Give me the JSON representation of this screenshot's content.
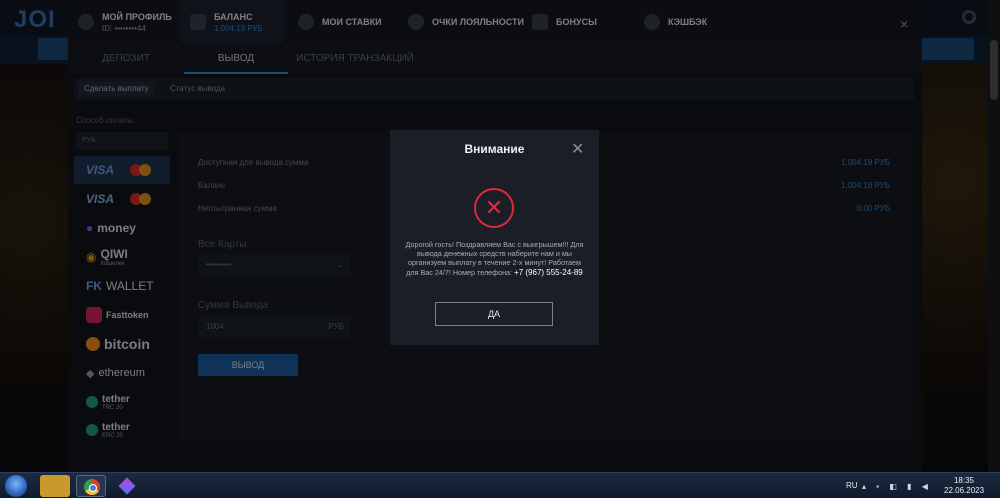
{
  "site": {
    "logo": "JOI"
  },
  "header": {
    "tabs": [
      {
        "title": "МОЙ ПРОФИЛЬ",
        "sub": "ID: ••••••••44",
        "icon": "user-icon"
      },
      {
        "title": "БАЛАНС",
        "sub": "1,004.19 РУБ",
        "icon": "wallet-icon"
      },
      {
        "title": "МОИ СТАВКИ",
        "icon": "trophy-icon"
      },
      {
        "title": "ОЧКИ ЛОЯЛЬНОСТИ",
        "icon": "star-icon"
      },
      {
        "title": "БОНУСЫ",
        "icon": "gift-icon"
      },
      {
        "title": "КЭШБЭК",
        "icon": "cashback-icon"
      }
    ],
    "close": "×",
    "lang": "RU"
  },
  "subtabs": [
    "ДЕПОЗИТ",
    "ВЫВОД",
    "ИСТОРИЯ ТРАНЗАКЦИЙ"
  ],
  "pills": [
    "Сделать выплату",
    "Статус вывода"
  ],
  "payment": {
    "label": "Способ оплаты",
    "currency": "РУБ",
    "methods": [
      {
        "name": "VISA",
        "icon": "mastercard-icon"
      },
      {
        "name": "VISA",
        "icon": "mastercard-icon"
      },
      {
        "name": "money",
        "icon": "yoomoney-icon"
      },
      {
        "name": "QIWI",
        "small": "Кошелек",
        "icon": "qiwi-icon"
      },
      {
        "name": "WALLET",
        "icon": "fk-icon"
      },
      {
        "name": "Fasttoken",
        "icon": "fasttoken-icon"
      },
      {
        "name": "bitcoin",
        "icon": "bitcoin-icon"
      },
      {
        "name": "ethereum",
        "icon": "ethereum-icon"
      },
      {
        "name": "tether",
        "small": "TRC 20",
        "icon": "tether-icon"
      },
      {
        "name": "tether",
        "small": "ERC 20",
        "icon": "tether-icon"
      }
    ]
  },
  "form": {
    "rows": [
      {
        "label": "Доступная для вывода сумма",
        "value": "1,004.19 РУБ"
      },
      {
        "label": "Баланс",
        "value": "1,004.19 РУБ"
      },
      {
        "label": "Неотыгранная сумма",
        "value": "0.00 РУБ"
      }
    ],
    "cards_label": "Все Карты",
    "card_value": "•••••••••",
    "amount_label": "Сумма Вывода",
    "amount_value": "1004",
    "amount_currency": "РУБ",
    "submit": "ВЫВОД"
  },
  "modal": {
    "title": "Внимание",
    "close": "✕",
    "icon": "error-x-icon",
    "message": "Дорогой гость! Поздравляем Вас с выигрышем!!! Для вывода денежных средств наберите нам и мы организуем выплату в течение 2-х минут! Работаем для Вас 24/7! Номер телефона: ",
    "phone": "+7 (967) 555-24-89",
    "ok": "ДА"
  },
  "taskbar": {
    "lang": "RU",
    "time": "18:35",
    "date": "22.06.2023"
  }
}
